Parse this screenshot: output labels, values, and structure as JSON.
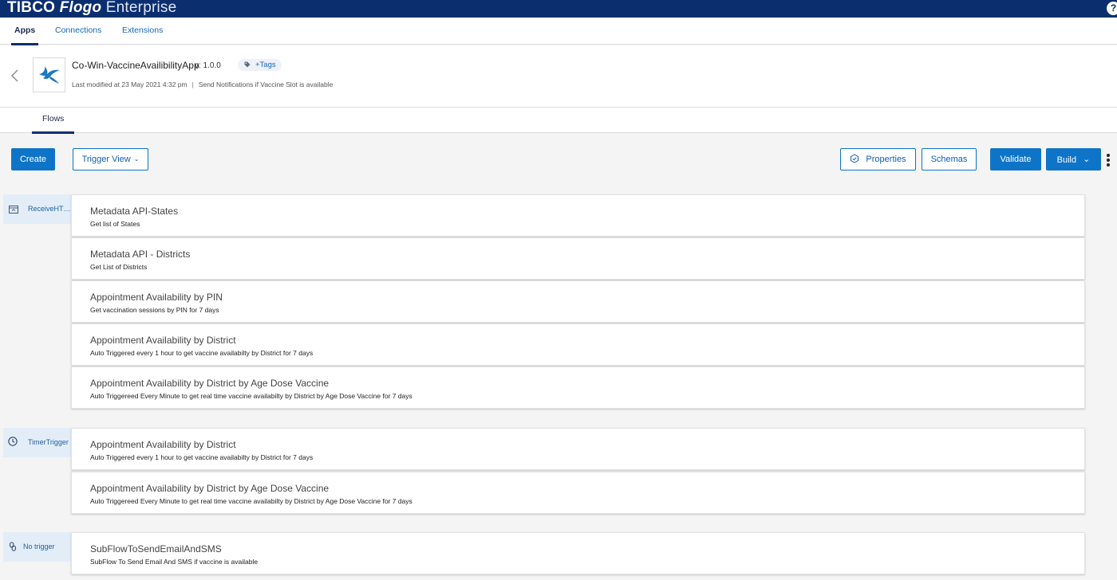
{
  "brand": {
    "part1": "TIBCO",
    "part2": "Flogo",
    "part3": " Enterprise"
  },
  "help_label": "?",
  "main_tabs": [
    {
      "label": "Apps",
      "active": true
    },
    {
      "label": "Connections",
      "active": false
    },
    {
      "label": "Extensions",
      "active": false
    }
  ],
  "app": {
    "name": "Co-Win-VaccineAvailibilityApp",
    "version": "v: 1.0.0",
    "tags_label": "+Tags",
    "last_modified": "Last modified at 23 May 2021 4:32 pm",
    "separator": "|",
    "description": "Send Notifications if Vaccine Slot is available"
  },
  "flows_tab": "Flows",
  "toolbar": {
    "create": "Create",
    "trigger_view": "Trigger View",
    "properties": "Properties",
    "schemas": "Schemas",
    "validate": "Validate",
    "build": "Build"
  },
  "groups": [
    {
      "trigger": "ReceiveHT…",
      "icon": "rest-trigger-icon",
      "flows": [
        {
          "title": "Metadata API-States",
          "desc": "Get list of States"
        },
        {
          "title": "Metadata API - Districts",
          "desc": "Get List of Districts"
        },
        {
          "title": "Appointment Availability by PIN",
          "desc": "Get vaccination sessions by PIN for 7 days"
        },
        {
          "title": "Appointment Availability by District",
          "desc": "Auto Triggered every 1 hour to get vaccine availabilty by District for 7 days"
        },
        {
          "title": "Appointment Availability by District by Age Dose Vaccine",
          "desc": "Auto Triggereed Every Minute to get real time vaccine availabilty by District by Age Dose Vaccine for 7 days"
        }
      ]
    },
    {
      "trigger": "TimerTrigger",
      "icon": "clock-icon",
      "flows": [
        {
          "title": "Appointment Availability by District",
          "desc": "Auto Triggered every 1 hour to get vaccine availabilty by District for 7 days"
        },
        {
          "title": "Appointment Availability by District by Age Dose Vaccine",
          "desc": "Auto Triggereed Every Minute to get real time vaccine availabilty by District by Age Dose Vaccine for 7 days"
        }
      ]
    },
    {
      "trigger": "No trigger",
      "icon": "link-icon",
      "flows": [
        {
          "title": "SubFlowToSendEmailAndSMS",
          "desc": "SubFlow To Send Email And SMS if vaccine is available"
        }
      ]
    }
  ],
  "colors": {
    "brand_bar": "#0b2e6f",
    "primary": "#0e74c8",
    "link": "#1468b8",
    "trigger_bg": "#e3edf8"
  }
}
